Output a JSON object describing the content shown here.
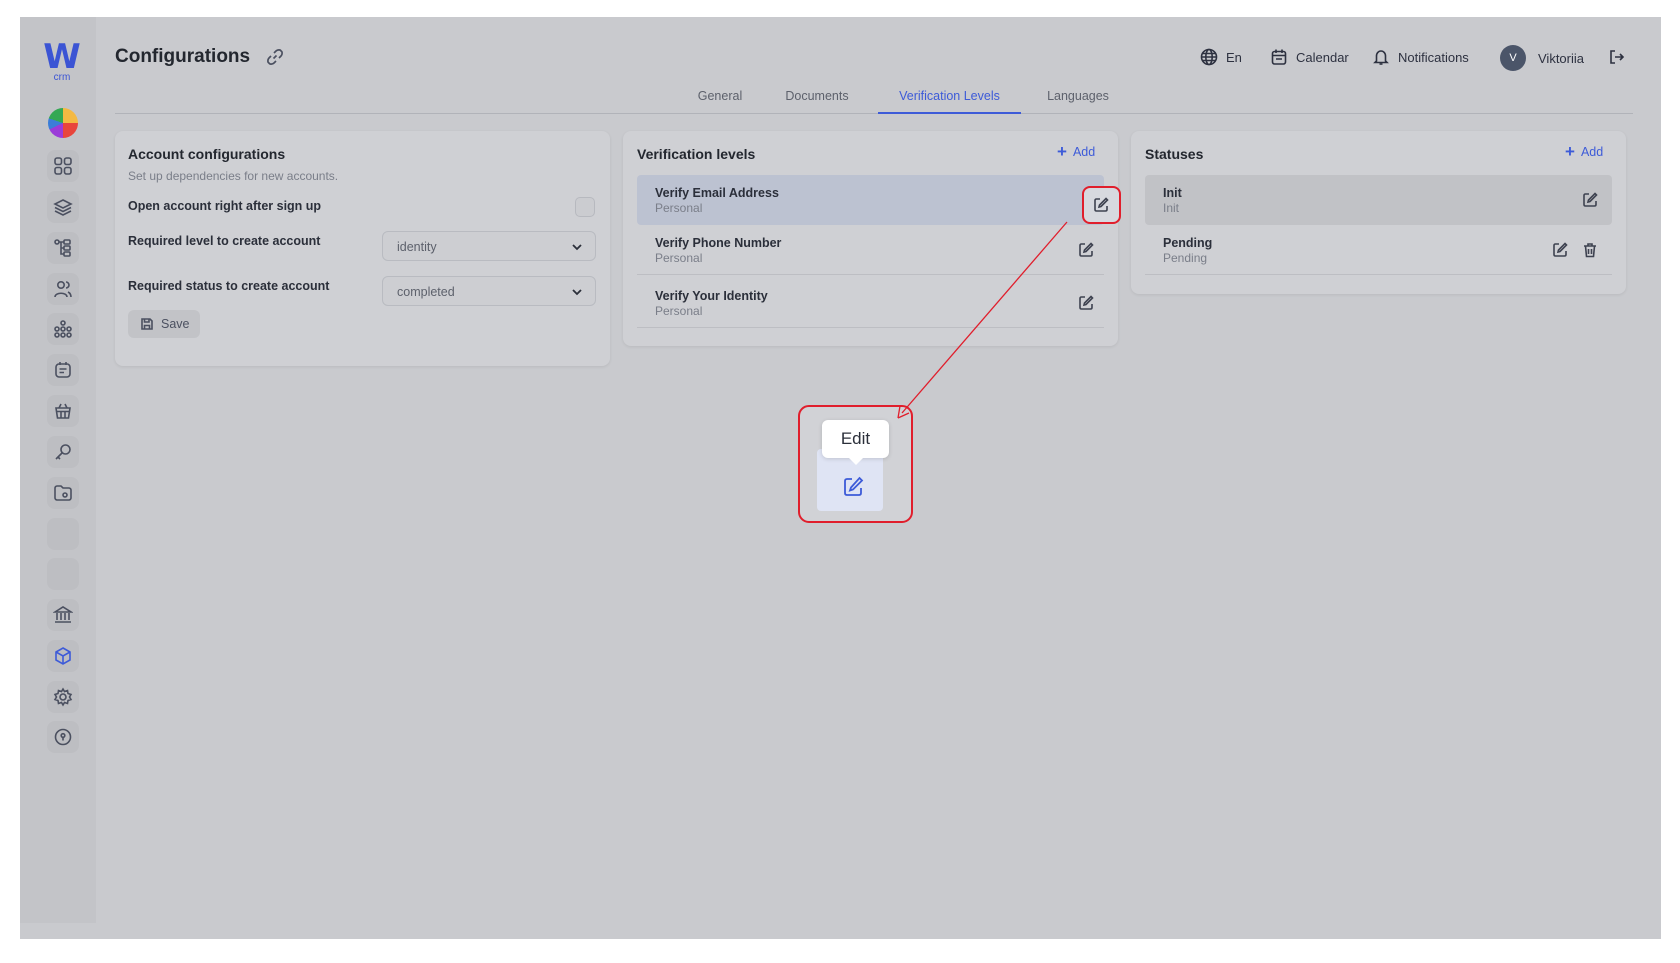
{
  "app": {
    "logo_letter": "W",
    "logo_sub": "crm",
    "page_title": "Configurations"
  },
  "header": {
    "language": "En",
    "calendar": "Calendar",
    "notifications": "Notifications",
    "user_initial": "V",
    "user_name": "Viktoriia"
  },
  "tabs": [
    {
      "label": "General",
      "active": false
    },
    {
      "label": "Documents",
      "active": false
    },
    {
      "label": "Verification Levels",
      "active": true
    },
    {
      "label": "Languages",
      "active": false
    }
  ],
  "account_config": {
    "title": "Account configurations",
    "subtitle": "Set up dependencies for new accounts.",
    "open_account_label": "Open account right  after sign up",
    "required_level_label": "Required level to create account",
    "required_level_value": "identity",
    "required_status_label": "Required status to create account",
    "required_status_value": "completed",
    "save_label": "Save"
  },
  "verification_levels": {
    "title": "Verification levels",
    "add_label": "Add",
    "items": [
      {
        "name": "Verify Email Address",
        "type": "Personal"
      },
      {
        "name": "Verify Phone Number",
        "type": "Personal"
      },
      {
        "name": "Verify Your Identity",
        "type": "Personal"
      }
    ]
  },
  "statuses": {
    "title": "Statuses",
    "add_label": "Add",
    "items": [
      {
        "name": "Init",
        "sub": "Init"
      },
      {
        "name": "Pending",
        "sub": "Pending"
      }
    ]
  },
  "callout": {
    "tooltip": "Edit"
  },
  "colors": {
    "accent": "#3d5bd8",
    "highlight": "#e01e2c"
  },
  "sidebar_icons": [
    "dashboard-icon",
    "layers-icon",
    "hierarchy-icon",
    "users-icon",
    "network-icon",
    "notes-icon",
    "basket-icon",
    "key-icon",
    "folder-icon",
    "blank",
    "blank",
    "bank-icon",
    "cube-icon",
    "gear-icon",
    "shield-icon"
  ]
}
